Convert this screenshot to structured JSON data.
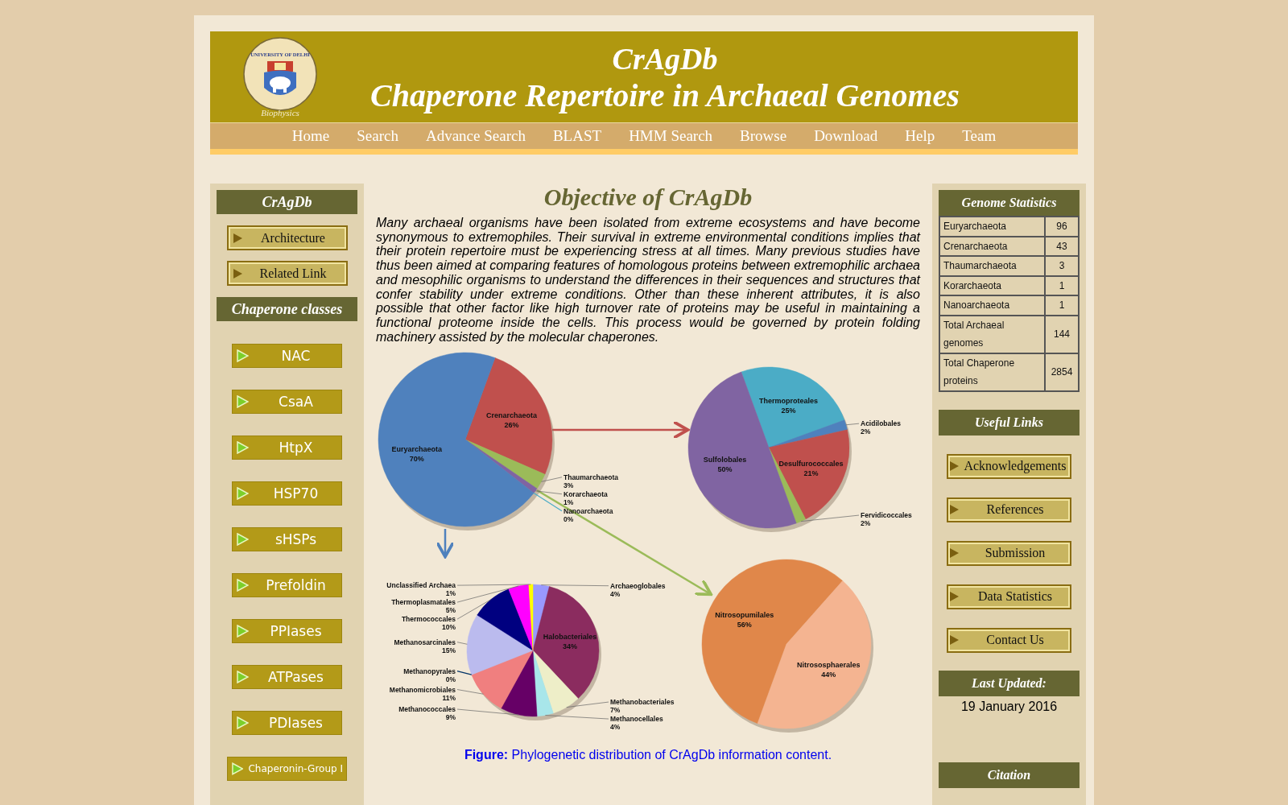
{
  "header": {
    "logo_arc_text": "UNIVERSITY OF DELHI",
    "logo_caption": "Biophysics",
    "title": "CrAgDb",
    "subtitle": "Chaperone Repertoire in Archaeal Genomes"
  },
  "nav": [
    "Home",
    "Search",
    "Advance Search",
    "BLAST",
    "HMM Search",
    "Browse",
    "Download",
    "Help",
    "Team"
  ],
  "left_sidebar": {
    "heading": "CrAgDb",
    "links": [
      "Architecture",
      "Related Link"
    ],
    "classes_heading": "Chaperone classes",
    "classes": [
      {
        "label": "NAC",
        "kind": "class"
      },
      {
        "label": "CsaA",
        "kind": "class"
      },
      {
        "label": "HtpX",
        "kind": "class"
      },
      {
        "label": "HSP70",
        "kind": "class"
      },
      {
        "label": "sHSPs",
        "kind": "class"
      },
      {
        "label": "Prefoldin",
        "kind": "class"
      },
      {
        "label": "PPIases",
        "kind": "class"
      },
      {
        "label": "ATPases",
        "kind": "class"
      },
      {
        "label": "PDIases",
        "kind": "class"
      },
      {
        "label": "Chaperonin-Group I",
        "kind": "wide"
      }
    ]
  },
  "main": {
    "title": "Objective of CrAgDb",
    "paragraph": "Many archaeal organisms have been isolated from extreme ecosystems and have become synonymous to extremophiles. Their survival in extreme environmental conditions implies that their protein repertoire must be experiencing stress at all times. Many previous studies have thus been aimed at comparing features of homologous proteins between extremophilic archaea and mesophilic organisms to understand the differences in their sequences and structures that confer stability under extreme conditions. Other than these inherent attributes, it is also possible that other factor like high turnover rate of proteins may be useful in maintaining a functional proteome inside the cells. This process would be governed by protein folding machinery assisted by the molecular chaperones.",
    "figure": {
      "charts": [
        {
          "chart_data": {
            "type": "pie",
            "categories": [
              "Crenarchaeota",
              "Thaumarchaeota",
              "Korarchaeota",
              "Nanoarchaeota",
              "Euryarchaeota"
            ],
            "series": [
              {
                "values": [
                  26,
                  3,
                  1,
                  0,
                  70
                ],
                "colors": [
                  "#c0504d",
                  "#9bbb59",
                  "#8064a2",
                  "#4bacc6",
                  "#4f81bd"
                ]
              }
            ],
            "value_labels": [
              "26%",
              "3%",
              "1%",
              "0%",
              "70%"
            ]
          }
        },
        {
          "chart_data": {
            "type": "pie",
            "categories": [
              "Thermoproteales",
              "Acidilobales",
              "Desulfurococcales",
              "Fervidicoccales",
              "Sulfolobales"
            ],
            "series": [
              {
                "values": [
                  25,
                  2,
                  21,
                  2,
                  50
                ],
                "colors": [
                  "#4bacc6",
                  "#4f81bd",
                  "#c0504d",
                  "#9bbb59",
                  "#8064a2"
                ]
              }
            ],
            "value_labels": [
              "25%",
              "2%",
              "21%",
              "2%",
              "50%"
            ]
          }
        },
        {
          "chart_data": {
            "type": "pie",
            "categories": [
              "Archaeoglobales",
              "Halobacteriales",
              "Methanobacteriales",
              "Methanocellales",
              "Methanococcales",
              "Methanomicrobiales",
              "Methanopyrales",
              "Methanosarcinales",
              "Thermococcales",
              "Thermoplasmatales",
              "Unclassified Archaea"
            ],
            "series": [
              {
                "values": [
                  4,
                  34,
                  7,
                  4,
                  9,
                  11,
                  0,
                  15,
                  10,
                  5,
                  1
                ],
                "colors": [
                  "#9999ff",
                  "#8b2c5f",
                  "#eeeec8",
                  "#a8e6ea",
                  "#660066",
                  "#f07f7f",
                  "#003366",
                  "#bbbbee",
                  "#000080",
                  "#ff00ff",
                  "#ffff00"
                ]
              }
            ],
            "value_labels": [
              "4%",
              "34%",
              "7%",
              "4%",
              "9%",
              "11%",
              "0%",
              "15%",
              "10%",
              "5%",
              "1%"
            ]
          }
        },
        {
          "chart_data": {
            "type": "pie",
            "categories": [
              "Nitrosopumilales",
              "Nitrososphaerales"
            ],
            "series": [
              {
                "values": [
                  56,
                  44
                ],
                "colors": [
                  "#e0874a",
                  "#f4b491"
                ]
              }
            ],
            "value_labels": [
              "56%",
              "44%"
            ]
          }
        }
      ],
      "caption": "**Figure:** Phylogenetic distribution of CrAgDb information content."
    }
  },
  "right_sidebar": {
    "stats_heading": "Genome Statistics",
    "stats": [
      {
        "label": "Euryarchaeota",
        "value": "96"
      },
      {
        "label": "Crenarchaeota",
        "value": "43"
      },
      {
        "label": "Thaumarchaeota",
        "value": "3"
      },
      {
        "label": "Korarchaeota",
        "value": "1"
      },
      {
        "label": "Nanoarchaeota",
        "value": "1"
      },
      {
        "label": "Total Archaeal genomes",
        "value": "144"
      },
      {
        "label": "Total Chaperone proteins",
        "value": "2854"
      }
    ],
    "links_heading": "Useful Links",
    "links": [
      "Acknowledgements",
      "References",
      "Submission",
      "Data Statistics",
      "Contact Us"
    ],
    "updated_heading": "Last Updated:",
    "updated_date": "19 January 2016",
    "citation_heading": "Citation"
  }
}
